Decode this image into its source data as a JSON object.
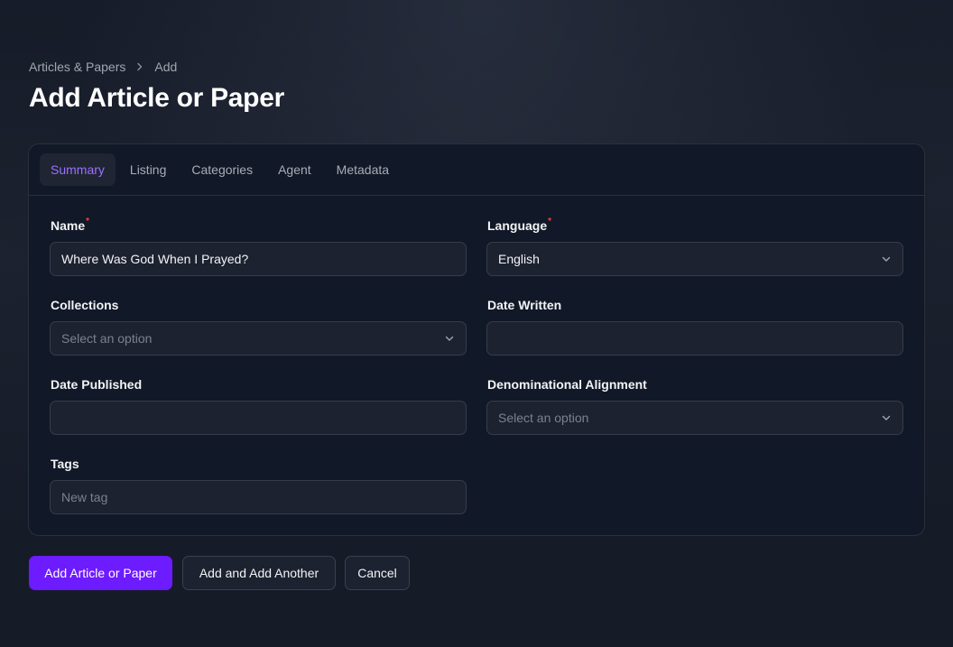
{
  "breadcrumb": {
    "parent": "Articles & Papers",
    "current": "Add"
  },
  "page_title": "Add Article or Paper",
  "tabs": [
    {
      "label": "Summary",
      "active": true
    },
    {
      "label": "Listing",
      "active": false
    },
    {
      "label": "Categories",
      "active": false
    },
    {
      "label": "Agent",
      "active": false
    },
    {
      "label": "Metadata",
      "active": false
    }
  ],
  "form": {
    "name": {
      "label": "Name",
      "required_mark": "*",
      "value": "Where Was God When I Prayed?"
    },
    "language": {
      "label": "Language",
      "required_mark": "*",
      "value": "English"
    },
    "collections": {
      "label": "Collections",
      "placeholder": "Select an option"
    },
    "date_written": {
      "label": "Date Written",
      "value": ""
    },
    "date_published": {
      "label": "Date Published",
      "value": ""
    },
    "denominational_alignment": {
      "label": "Denominational Alignment",
      "placeholder": "Select an option"
    },
    "tags": {
      "label": "Tags",
      "placeholder": "New tag"
    }
  },
  "actions": {
    "primary_label": "Add Article or Paper",
    "add_another_label": "Add and Add Another",
    "cancel_label": "Cancel"
  },
  "colors": {
    "accent": "#6d1bff",
    "active_tab_text": "#9d6fff",
    "required": "#ef4444",
    "background": "#161b28",
    "card": "#111827"
  }
}
